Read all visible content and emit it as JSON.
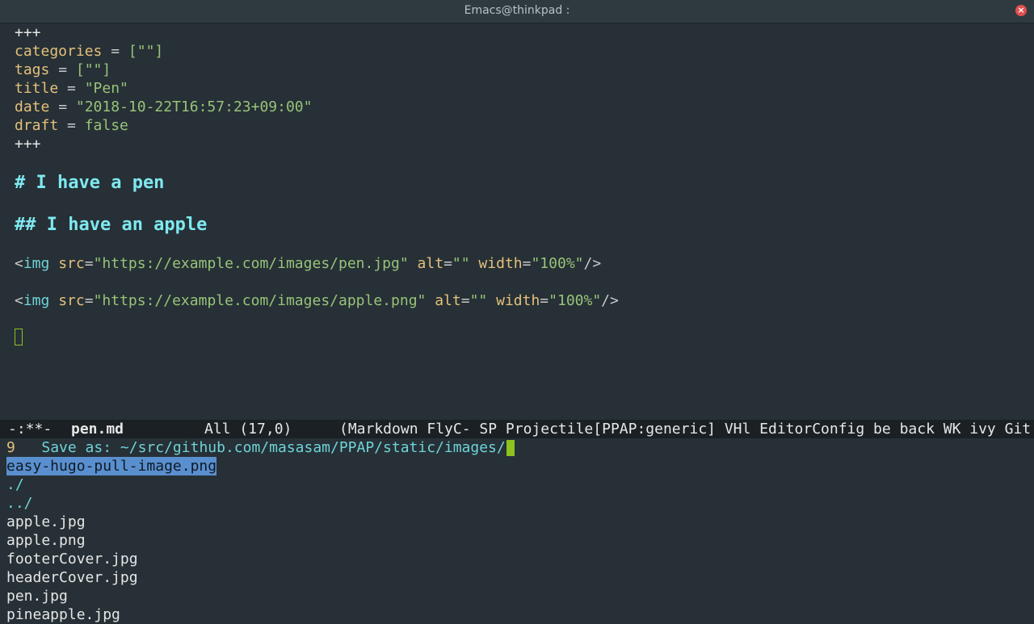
{
  "window": {
    "title": "Emacs@thinkpad :",
    "close_glyph": "×"
  },
  "editor": {
    "front_matter_delim": "+++",
    "front_matter": [
      {
        "key": "categories",
        "op": " = ",
        "value": "[\"\"]"
      },
      {
        "key": "tags",
        "op": " = ",
        "value": "[\"\"]"
      },
      {
        "key": "title",
        "op": " = ",
        "value": "\"Pen\""
      },
      {
        "key": "date",
        "op": " = ",
        "value": "\"2018-10-22T16:57:23+09:00\""
      },
      {
        "key": "draft",
        "op": " = ",
        "value": "false"
      }
    ],
    "h1": "# I have a pen",
    "h2": "## I have an apple",
    "img_lines": [
      {
        "open": "<",
        "tag": "img",
        "src_attr": " src",
        "src_eq": "=",
        "src_val": "\"https://example.com/images/pen.jpg\"",
        "alt_attr": " alt",
        "alt_eq": "=",
        "alt_val": "\"\"",
        "width_attr": " width",
        "width_eq": "=",
        "width_val": "\"100%\"",
        "close": "/>"
      },
      {
        "open": "<",
        "tag": "img",
        "src_attr": " src",
        "src_eq": "=",
        "src_val": "\"https://example.com/images/apple.png\"",
        "alt_attr": " alt",
        "alt_eq": "=",
        "alt_val": "\"\"",
        "width_attr": " width",
        "width_eq": "=",
        "width_val": "\"100%\"",
        "close": "/>"
      }
    ]
  },
  "modeline": {
    "status": "-:**-",
    "buffer": "pen.md",
    "position": "All (17,0)",
    "modes": "(Markdown FlyC- SP Projectile[PPAP:generic] VHl EditorConfig be back WK ivy Git"
  },
  "minibuffer": {
    "count": "9",
    "prompt": "Save as: ",
    "path": "~/src/github.com/masasam/PPAP/static/images/"
  },
  "candidates": [
    {
      "name": "easy-hugo-pull-image.png",
      "selected": true,
      "dir": false
    },
    {
      "name": "./",
      "selected": false,
      "dir": true
    },
    {
      "name": "../",
      "selected": false,
      "dir": true
    },
    {
      "name": "apple.jpg",
      "selected": false,
      "dir": false
    },
    {
      "name": "apple.png",
      "selected": false,
      "dir": false
    },
    {
      "name": "footerCover.jpg",
      "selected": false,
      "dir": false
    },
    {
      "name": "headerCover.jpg",
      "selected": false,
      "dir": false
    },
    {
      "name": "pen.jpg",
      "selected": false,
      "dir": false
    },
    {
      "name": "pineapple.jpg",
      "selected": false,
      "dir": false
    }
  ],
  "colors": {
    "background": "#263036",
    "cursor": "#8ec21f",
    "selection": "#5a8fcf",
    "heading": "#7fe8f0",
    "string": "#98c379",
    "keyword": "#e5c07b"
  }
}
